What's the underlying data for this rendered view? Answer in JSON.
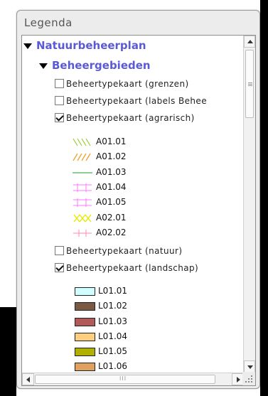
{
  "panel": {
    "title": "Legenda"
  },
  "tree": {
    "root_label": "Natuurbeheerplan",
    "group_label": "Beheergebieden",
    "layers": [
      {
        "label": "Beheertypekaart (grenzen)",
        "checked": false
      },
      {
        "label": "Beheertypekaart (labels Behee",
        "checked": false
      },
      {
        "label": "Beheertypekaart (agrarisch)",
        "checked": true
      },
      {
        "label": "Beheertypekaart (natuur)",
        "checked": false
      },
      {
        "label": "Beheertypekaart (landschap)",
        "checked": true
      }
    ],
    "agrarisch_items": [
      {
        "code": "A01.01",
        "icon": "diagonal-hatch-green",
        "color": "#9acd32"
      },
      {
        "code": "A01.02",
        "icon": "diagonal-hatch-orange",
        "color": "#f0a030"
      },
      {
        "code": "A01.03",
        "icon": "horizontal-line-green",
        "color": "#4caf50"
      },
      {
        "code": "A01.04",
        "icon": "grid-pink",
        "color": "#ff77ff"
      },
      {
        "code": "A01.05",
        "icon": "grid-pink",
        "color": "#ff77ff"
      },
      {
        "code": "A02.01",
        "icon": "cross-hatch-yellow",
        "color": "#e8e800"
      },
      {
        "code": "A02.02",
        "icon": "cross-pink",
        "color": "#ff88aa"
      }
    ],
    "landschap_items": [
      {
        "code": "L01.01",
        "color": "#cfffff"
      },
      {
        "code": "L01.02",
        "color": "#7a5a44"
      },
      {
        "code": "L01.03",
        "color": "#b05a5a"
      },
      {
        "code": "L01.04",
        "color": "#ffcf80"
      },
      {
        "code": "L01.05",
        "color": "#b0b000"
      },
      {
        "code": "L01.06",
        "color": "#e0a060"
      }
    ]
  },
  "scrollbar": {
    "h_thumb_grip": "III",
    "v_thumb_grip": "≡"
  }
}
